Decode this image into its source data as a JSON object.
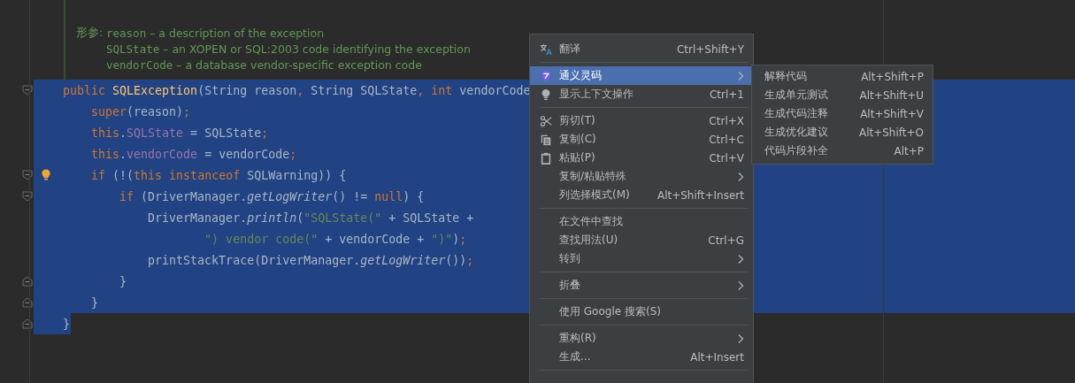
{
  "doc_comment": {
    "label": "形参:",
    "params": [
      {
        "name": "reason",
        "description": "– a description of the exception"
      },
      {
        "name": "SQLState",
        "description": "– an XOPEN or SQL:2003 code identifying the exception"
      },
      {
        "name": "vendorCode",
        "description": "– a database vendor-specific exception code"
      }
    ]
  },
  "code": {
    "lines": [
      {
        "fold_start": true,
        "fold_end": false,
        "bulb": false,
        "selected": true,
        "tokens": [
          {
            "text": "public ",
            "kind": "keyword"
          },
          {
            "text": "SQLException",
            "kind": "declaration"
          },
          {
            "text": "(String reason",
            "kind": "plain"
          },
          {
            "text": ",",
            "kind": "keyword"
          },
          {
            "text": " String SQLState",
            "kind": "plain"
          },
          {
            "text": ",",
            "kind": "keyword"
          },
          {
            "text": " int",
            "kind": "keyword"
          },
          {
            "text": " vendorCode",
            "kind": "plain"
          }
        ]
      },
      {
        "fold_start": false,
        "fold_end": false,
        "bulb": false,
        "selected": true,
        "tokens": [
          {
            "text": "    super",
            "kind": "keyword"
          },
          {
            "text": "(reason)",
            "kind": "plain"
          },
          {
            "text": ";",
            "kind": "keyword"
          }
        ]
      },
      {
        "fold_start": false,
        "fold_end": false,
        "bulb": false,
        "selected": true,
        "tokens": [
          {
            "text": "    this",
            "kind": "keyword"
          },
          {
            "text": ".",
            "kind": "plain"
          },
          {
            "text": "SQLState",
            "kind": "field"
          },
          {
            "text": " = SQLState",
            "kind": "plain"
          },
          {
            "text": ";",
            "kind": "keyword"
          }
        ]
      },
      {
        "fold_start": false,
        "fold_end": false,
        "bulb": false,
        "selected": true,
        "tokens": [
          {
            "text": "    this",
            "kind": "keyword"
          },
          {
            "text": ".",
            "kind": "plain"
          },
          {
            "text": "vendorCode",
            "kind": "field"
          },
          {
            "text": " = vendorCode",
            "kind": "plain"
          },
          {
            "text": ";",
            "kind": "keyword"
          }
        ]
      },
      {
        "fold_start": true,
        "fold_end": false,
        "bulb": true,
        "selected": true,
        "tokens": [
          {
            "text": "    if",
            "kind": "keyword"
          },
          {
            "text": " (!(",
            "kind": "plain"
          },
          {
            "text": "this instanceof",
            "kind": "keyword"
          },
          {
            "text": " SQLWarning)) {",
            "kind": "plain"
          }
        ]
      },
      {
        "fold_start": true,
        "fold_end": false,
        "bulb": false,
        "selected": true,
        "tokens": [
          {
            "text": "        if",
            "kind": "keyword"
          },
          {
            "text": " (DriverManager.",
            "kind": "plain"
          },
          {
            "text": "getLogWriter",
            "kind": "static"
          },
          {
            "text": "() != ",
            "kind": "plain"
          },
          {
            "text": "null",
            "kind": "keyword"
          },
          {
            "text": ") {",
            "kind": "plain"
          }
        ]
      },
      {
        "fold_start": false,
        "fold_end": false,
        "bulb": false,
        "selected": true,
        "tokens": [
          {
            "text": "            DriverManager.",
            "kind": "plain"
          },
          {
            "text": "println",
            "kind": "static"
          },
          {
            "text": "(",
            "kind": "plain"
          },
          {
            "text": "\"SQLState(\"",
            "kind": "string"
          },
          {
            "text": " + SQLState +",
            "kind": "plain"
          }
        ]
      },
      {
        "fold_start": false,
        "fold_end": false,
        "bulb": false,
        "selected": true,
        "tokens": [
          {
            "text": "                    \") vendor code(\"",
            "kind": "string"
          },
          {
            "text": " + vendorCode + ",
            "kind": "plain"
          },
          {
            "text": "\")\"",
            "kind": "string"
          },
          {
            "text": ")",
            "kind": "plain"
          },
          {
            "text": ";",
            "kind": "keyword"
          }
        ]
      },
      {
        "fold_start": false,
        "fold_end": false,
        "bulb": false,
        "selected": true,
        "tokens": [
          {
            "text": "            printStackTrace(DriverManager.",
            "kind": "plain"
          },
          {
            "text": "getLogWriter",
            "kind": "static"
          },
          {
            "text": "())",
            "kind": "plain"
          },
          {
            "text": ";",
            "kind": "keyword"
          }
        ]
      },
      {
        "fold_start": false,
        "fold_end": true,
        "bulb": false,
        "selected": true,
        "tokens": [
          {
            "text": "        }",
            "kind": "plain"
          }
        ]
      },
      {
        "fold_start": false,
        "fold_end": true,
        "bulb": false,
        "selected": true,
        "tokens": [
          {
            "text": "    }",
            "kind": "plain"
          }
        ]
      },
      {
        "fold_start": false,
        "fold_end": true,
        "bulb": false,
        "selected": true,
        "tokens": [
          {
            "text": "}",
            "kind": "plain"
          }
        ]
      }
    ]
  },
  "context_menu": {
    "items": [
      {
        "kind": "item",
        "label": "翻译",
        "shortcut": "Ctrl+Shift+Y",
        "submenu": false,
        "selected": false
      },
      {
        "kind": "separator"
      },
      {
        "kind": "item",
        "label": "通义灵码",
        "submenu": true,
        "selected": true
      },
      {
        "kind": "item",
        "label": "显示上下文操作",
        "shortcut": "Ctrl+1",
        "submenu": false,
        "selected": false
      },
      {
        "kind": "separator"
      },
      {
        "kind": "item",
        "label": "剪切(T)",
        "shortcut": "Ctrl+X",
        "submenu": false,
        "selected": false
      },
      {
        "kind": "item",
        "label": "复制(C)",
        "shortcut": "Ctrl+C",
        "submenu": false,
        "selected": false
      },
      {
        "kind": "item",
        "label": "粘贴(P)",
        "shortcut": "Ctrl+V",
        "submenu": false,
        "selected": false
      },
      {
        "kind": "item",
        "label": "复制/粘贴特殊",
        "submenu": true,
        "selected": false
      },
      {
        "kind": "item",
        "label": "列选择模式(M)",
        "shortcut": "Alt+Shift+Insert",
        "submenu": false,
        "selected": false
      },
      {
        "kind": "separator"
      },
      {
        "kind": "item",
        "label": "在文件中查找",
        "submenu": false,
        "selected": false
      },
      {
        "kind": "item",
        "label": "查找用法(U)",
        "shortcut": "Ctrl+G",
        "submenu": false,
        "selected": false
      },
      {
        "kind": "item",
        "label": "转到",
        "submenu": true,
        "selected": false
      },
      {
        "kind": "separator"
      },
      {
        "kind": "item",
        "label": "折叠",
        "submenu": true,
        "selected": false
      },
      {
        "kind": "separator"
      },
      {
        "kind": "item",
        "label": "使用 Google 搜索(S)",
        "submenu": false,
        "selected": false
      },
      {
        "kind": "separator"
      },
      {
        "kind": "item",
        "label": "重构(R)",
        "submenu": true,
        "selected": false
      },
      {
        "kind": "item",
        "label": "生成...",
        "shortcut": "Alt+Insert",
        "submenu": false,
        "selected": false
      },
      {
        "kind": "separator"
      }
    ]
  },
  "submenu": {
    "items": [
      {
        "label": "解释代码",
        "shortcut": "Alt+Shift+P",
        "selected": false
      },
      {
        "label": "生成单元测试",
        "shortcut": "Alt+Shift+U",
        "selected": false
      },
      {
        "label": "生成代码注释",
        "shortcut": "Alt+Shift+V",
        "selected": false
      },
      {
        "label": "生成优化建议",
        "shortcut": "Alt+Shift+O",
        "selected": false
      },
      {
        "label": "代码片段补全",
        "shortcut": "Alt+P",
        "selected": false
      }
    ]
  }
}
